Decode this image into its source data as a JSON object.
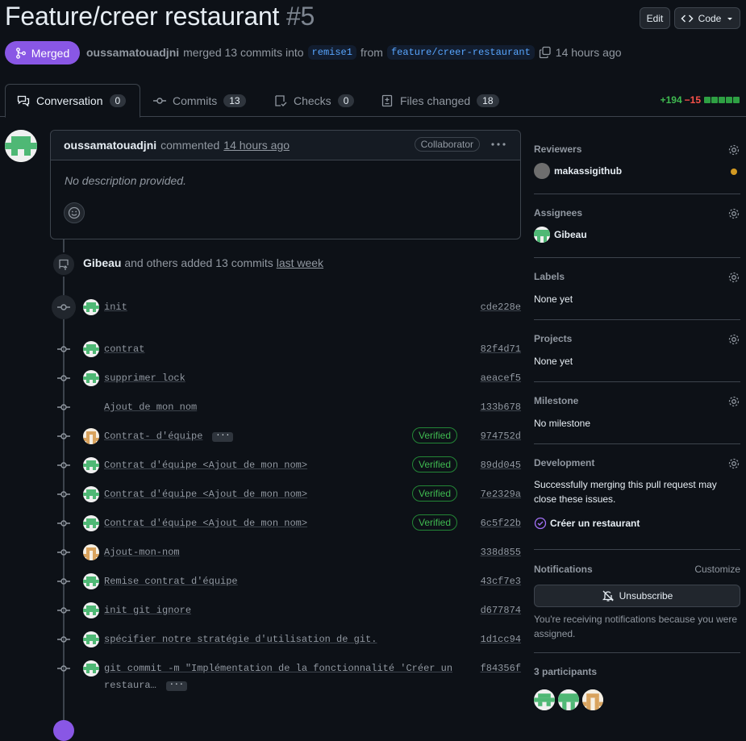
{
  "pr": {
    "title": "Feature/creer restaurant",
    "number": "#5",
    "state": "Merged",
    "author": "oussamatouadjni",
    "merge_text": "merged 13 commits into",
    "base_branch": "remise1",
    "from_text": "from",
    "head_branch": "feature/creer-restaurant",
    "time": "14 hours ago"
  },
  "header_buttons": {
    "edit": "Edit",
    "code": "Code"
  },
  "tabs": [
    {
      "label": "Conversation",
      "count": "0"
    },
    {
      "label": "Commits",
      "count": "13"
    },
    {
      "label": "Checks",
      "count": "0"
    },
    {
      "label": "Files changed",
      "count": "18"
    }
  ],
  "diffstat": {
    "additions": "+194",
    "deletions": "−15"
  },
  "comment": {
    "author": "oussamatouadjni",
    "action": "commented",
    "time": "14 hours ago",
    "badge": "Collaborator",
    "body": "No description provided."
  },
  "commit_group": {
    "author": "Gibeau",
    "text": "and others added 13 commits",
    "time": "last week"
  },
  "commits": [
    {
      "message": "init",
      "sha": "cde228e",
      "avatar": "green",
      "verified": ""
    },
    {
      "message": "contrat",
      "sha": "82f4d71",
      "avatar": "green",
      "verified": ""
    },
    {
      "message": "supprimer lock",
      "sha": "aeacef5",
      "avatar": "green",
      "verified": ""
    },
    {
      "message": "Ajout de mon nom",
      "sha": "133b678",
      "avatar": "none",
      "verified": ""
    },
    {
      "message": "Contrat- d'équipe",
      "sha": "974752d",
      "avatar": "orange",
      "verified": "Verified"
    },
    {
      "message": "Contrat d'équipe <Ajout de mon nom>",
      "sha": "89dd045",
      "avatar": "green",
      "verified": "Verified"
    },
    {
      "message": "Contrat d'équipe <Ajout de mon nom>",
      "sha": "7e2329a",
      "avatar": "green",
      "verified": "Verified"
    },
    {
      "message": "Contrat d'équipe <Ajout de mon nom>",
      "sha": "6c5f22b",
      "avatar": "green",
      "verified": "Verified"
    },
    {
      "message": "Ajout-mon-nom",
      "sha": "338d855",
      "avatar": "orange",
      "verified": ""
    },
    {
      "message": "Remise contrat d'équipe",
      "sha": "43cf7e3",
      "avatar": "green",
      "verified": ""
    },
    {
      "message": "init git ignore",
      "sha": "d677874",
      "avatar": "green",
      "verified": ""
    },
    {
      "message": "spécifier notre stratégie d'utilisation de git.",
      "sha": "1d1cc94",
      "avatar": "green",
      "verified": ""
    },
    {
      "message": "git commit -m \"Implémentation de la fonctionnalité 'Créer un",
      "message2": "restaura…",
      "sha": "f84356f",
      "avatar": "green",
      "verified": ""
    }
  ],
  "sidebar": {
    "reviewers": {
      "title": "Reviewers",
      "value": "makassigithub"
    },
    "assignees": {
      "title": "Assignees",
      "value": "Gibeau"
    },
    "labels": {
      "title": "Labels",
      "value": "None yet"
    },
    "projects": {
      "title": "Projects",
      "value": "None yet"
    },
    "milestone": {
      "title": "Milestone",
      "value": "No milestone"
    },
    "development": {
      "title": "Development",
      "text": "Successfully merging this pull request may close these issues.",
      "issue": "Créer un restaurant"
    },
    "notifications": {
      "title": "Notifications",
      "customize": "Customize",
      "button": "Unsubscribe",
      "text": "You're receiving notifications because you were assigned."
    },
    "participants": {
      "title": "3 participants"
    }
  },
  "colors": {
    "merged": "#8957e5",
    "add": "#3fb950",
    "del": "#f85149",
    "link": "#58a6ff",
    "pending": "#d29922"
  }
}
